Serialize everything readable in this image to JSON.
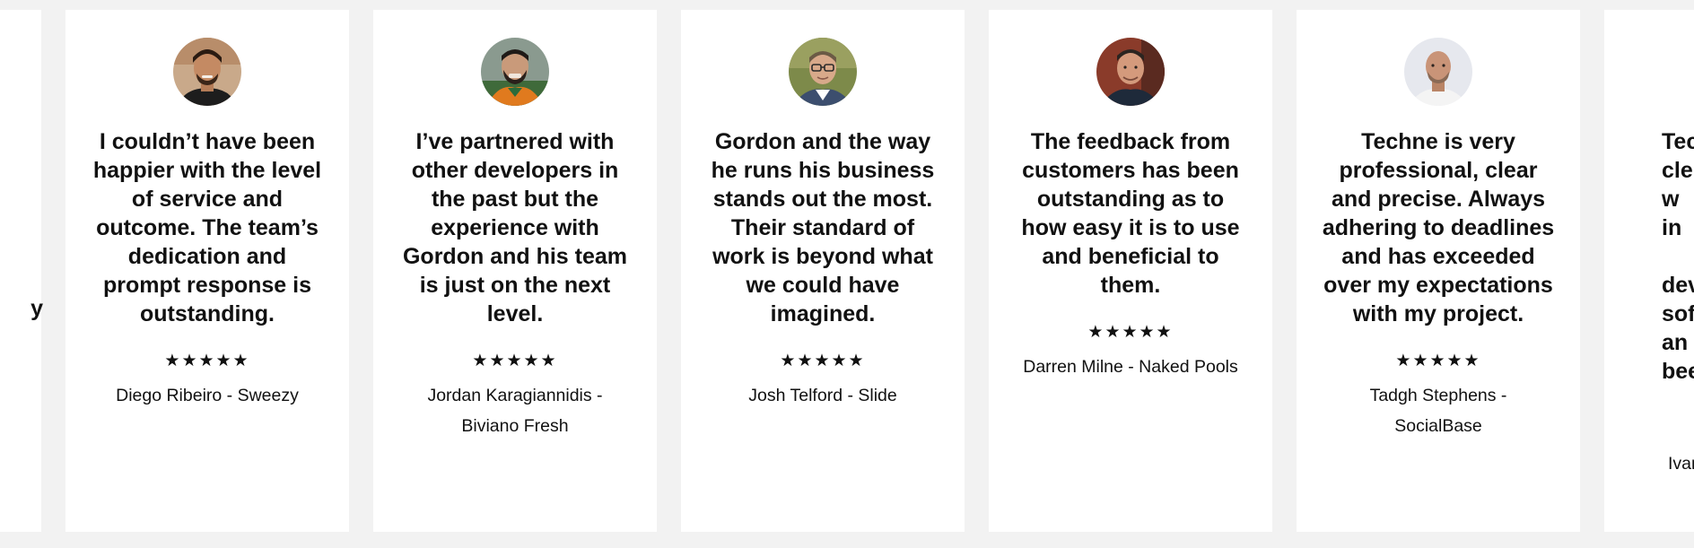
{
  "testimonials": [
    {
      "quote": "",
      "stars": "",
      "author": "",
      "left_fragment": "y"
    },
    {
      "quote": "I couldn’t have been happier with the level of service and outcome. The team’s dedication and prompt response is outstanding.",
      "stars": "★★★★★",
      "author": "Diego Ribeiro - Sweezy",
      "avatar": {
        "skin": "#c48a63",
        "hair": "#2a1b12",
        "bg": "#c9a98a",
        "shirt": "#1d1d1d"
      }
    },
    {
      "quote": "I’ve partnered with other developers in the past but the experience with Gordon and his team is just on the next level.",
      "stars": "★★★★★",
      "author": "Jordan Karagiannidis - Biviano Fresh",
      "avatar": {
        "skin": "#c99a7a",
        "hair": "#1f1a17",
        "bg": "#8a9a8f",
        "shirt": "#e07a1e"
      }
    },
    {
      "quote": "Gordon and the way he runs his business stands out the most. Their standard of work is beyond what we could have imagined.",
      "stars": "★★★★★",
      "author": "Josh Telford - Slide",
      "avatar": {
        "skin": "#d8a98a",
        "hair": "#6b5a45",
        "bg": "#7d8a4a",
        "shirt": "#3c4e6e"
      }
    },
    {
      "quote": "The feedback from customers has been outstanding as to how easy it is to use and beneficial to them.",
      "stars": "★★★★★",
      "author": "Darren Milne - Naked Pools",
      "avatar": {
        "skin": "#d49a7c",
        "hair": "#2b2420",
        "bg": "#8a3b2a",
        "shirt": "#1e2a3a"
      }
    },
    {
      "quote": "Techne is very professional, clear and precise. Always adhering to deadlines and has exceeded over my expectations with my project.",
      "stars": "★★★★★",
      "author": "Tadgh Stephens - SocialBase",
      "avatar": {
        "skin": "#c99478",
        "hair": "#8a6a55",
        "bg": "#e6e8ee",
        "shirt": "#f4f4f4"
      }
    },
    {
      "quote_lines": [
        "Tec",
        "cle",
        "w",
        "in",
        "",
        "deve",
        "softv",
        "an",
        "bee"
      ],
      "author": "Ivar"
    }
  ]
}
